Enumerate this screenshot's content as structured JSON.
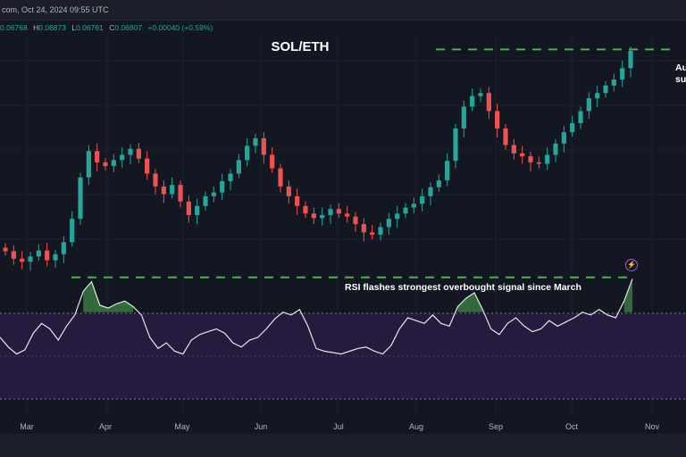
{
  "header": {
    "source_date": "com, Oct 24, 2024 09:55 UTC"
  },
  "ohlc": {
    "open_value": "0.06768",
    "high_label": "H",
    "high_value": "0.06873",
    "low_label": "L",
    "low_value": "0.06761",
    "close_label": "C",
    "close_value": "0.06807",
    "change": "+0.00040 (+0.59%)"
  },
  "chart_data": {
    "type": "line",
    "title": "SOL/ETH",
    "x_tick_labels": [
      "Mar",
      "Apr",
      "May",
      "Jun",
      "Jul",
      "Aug",
      "Sep",
      "Oct",
      "Nov"
    ],
    "grid": true,
    "price_panel": {
      "kind": "candlestick",
      "up_color": "#26a69a",
      "down_color": "#ef5350",
      "approx_close_series": [
        0.0462,
        0.0452,
        0.0448,
        0.0455,
        0.0463,
        0.045,
        0.0458,
        0.0474,
        0.0505,
        0.056,
        0.0595,
        0.058,
        0.0575,
        0.0583,
        0.059,
        0.0598,
        0.0585,
        0.0565,
        0.0548,
        0.0538,
        0.055,
        0.0528,
        0.051,
        0.0522,
        0.0535,
        0.054,
        0.0555,
        0.0565,
        0.0583,
        0.0602,
        0.0612,
        0.059,
        0.0572,
        0.0548,
        0.0535,
        0.0522,
        0.0512,
        0.0506,
        0.051,
        0.0518,
        0.0512,
        0.0508,
        0.0498,
        0.0487,
        0.0484,
        0.0494,
        0.0505,
        0.0512,
        0.052,
        0.0525,
        0.0535,
        0.0547,
        0.0556,
        0.0582,
        0.0625,
        0.0654,
        0.0668,
        0.0672,
        0.0648,
        0.0625,
        0.0603,
        0.0592,
        0.0588,
        0.058,
        0.0578,
        0.059,
        0.0605,
        0.062,
        0.0632,
        0.0648,
        0.0665,
        0.0672,
        0.0682,
        0.069,
        0.0705,
        0.0728
      ],
      "resistance_level": 0.073,
      "annotation": "Au su"
    },
    "rsi_panel": {
      "series_color": "#e0e0e0",
      "approx_values": [
        52,
        45,
        40,
        43,
        55,
        62,
        58,
        50,
        60,
        68,
        85,
        92,
        75,
        73,
        76,
        78,
        74,
        68,
        52,
        44,
        48,
        42,
        40,
        50,
        54,
        56,
        58,
        55,
        48,
        45,
        50,
        52,
        58,
        65,
        70,
        68,
        72,
        60,
        44,
        42,
        41,
        40,
        42,
        44,
        45,
        42,
        40,
        46,
        58,
        66,
        64,
        62,
        68,
        62,
        60,
        74,
        80,
        84,
        72,
        58,
        54,
        62,
        66,
        60,
        56,
        58,
        64,
        60,
        63,
        66,
        70,
        68,
        72,
        68,
        66,
        78,
        94
      ],
      "band_upper": 70,
      "band_lower": 30,
      "overbought_level": 95,
      "annotation": "RSI flashes strongest overbought signal since March"
    }
  },
  "icons": {
    "replay": "lightning-icon"
  }
}
